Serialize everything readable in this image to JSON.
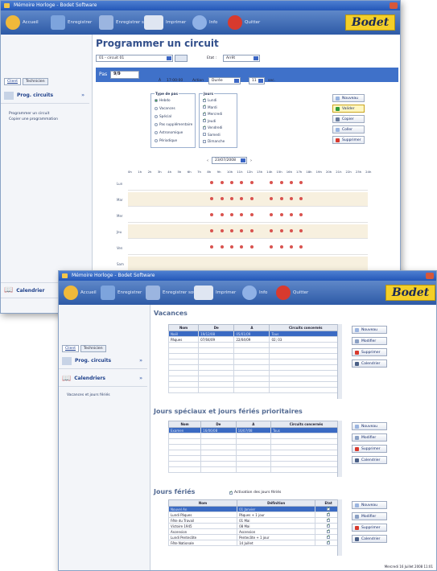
{
  "window1": {
    "title": "Mémoire Horloge - Bodet Software",
    "toolbar": {
      "home": "Accueil",
      "save": "Enregistrer",
      "save_as": "Enregistrer sous",
      "print": "Imprimer",
      "info": "Info",
      "quit": "Quitter"
    },
    "logo": "Bodet",
    "tabs": [
      "Client",
      "Technicien"
    ],
    "nav": {
      "heading": "Prog. circuits",
      "items": [
        "Programmer un circuit",
        "Copier une programmation"
      ],
      "calendar": "Calendrier"
    },
    "page_title": "Programmer un circuit",
    "circuit_select": "01 - circuit 01",
    "state_label": "Etat :",
    "state_value": "Arrêt",
    "pas_label": "Pas",
    "pas_value": "9/9",
    "time_prefix": "À",
    "time_value": "17:00:00",
    "action_label": "Action",
    "action_value": "Durée",
    "duration_value": "11",
    "duration_unit": "sec.",
    "type_group": {
      "title": "Type de pas",
      "items": [
        "Hebdo",
        "Vacances",
        "Spécial",
        "Pas supplémentaire",
        "Astronomique",
        "Périodique"
      ],
      "selected": 0
    },
    "days_group": {
      "title": "Jours",
      "items": [
        "Lundi",
        "Mardi",
        "Mercredi",
        "Jeudi",
        "Vendredi",
        "Samedi",
        "Dimanche"
      ],
      "checked": [
        true,
        true,
        true,
        true,
        true,
        false,
        false
      ]
    },
    "buttons": [
      "Nouveau",
      "Valider",
      "Copier",
      "Coller",
      "Supprimer"
    ],
    "date_nav": {
      "prev": "‹",
      "date": "23/07/2008",
      "next": "›"
    },
    "hours": [
      "0h",
      "1h",
      "2h",
      "3h",
      "4h",
      "5h",
      "6h",
      "7h",
      "8h",
      "9h",
      "10h",
      "11h",
      "12h",
      "13h",
      "14h",
      "15h",
      "16h",
      "17h",
      "18h",
      "19h",
      "20h",
      "21h",
      "22h",
      "23h",
      "24h"
    ],
    "days": [
      "Lun",
      "Mar",
      "Mer",
      "Jeu",
      "Ven",
      "Sam"
    ]
  },
  "window2": {
    "title": "Mémoire Horloge - Bodet Software",
    "logo": "Bodet",
    "tabs": [
      "Client",
      "Technicien"
    ],
    "nav": {
      "heading1": "Prog. circuits",
      "heading2": "Calendriers",
      "sub": "Vacances et jours fériés"
    },
    "vacances": {
      "title": "Vacances",
      "headers": [
        "Nom",
        "De",
        "A",
        "Circuits concernés"
      ],
      "rows": [
        [
          "Noël",
          "19/12/08",
          "05/01/09",
          "Tous"
        ],
        [
          "Pâques",
          "07/04/09",
          "22/04/09",
          "02; 03"
        ]
      ]
    },
    "speciaux": {
      "title": "Jours spéciaux et jours fériés prioritaires",
      "headers": [
        "Nom",
        "De",
        "A",
        "Circuits concernés"
      ],
      "rows": [
        [
          "Examen",
          "16/06/08",
          "16/07/08",
          "Tous"
        ]
      ]
    },
    "feries": {
      "title": "Jours fériés",
      "activation": "Activation des jours fériés",
      "headers": [
        "Nom",
        "Définition",
        "Etat"
      ],
      "rows": [
        [
          "Nouvel An",
          "01 Janvier"
        ],
        [
          "Lundi Pâques",
          "Pâques + 1 jour"
        ],
        [
          "Fête du Travail",
          "01 Mai"
        ],
        [
          "Victoire 1945",
          "08 Mai"
        ],
        [
          "Ascension",
          "Ascension"
        ],
        [
          "Lundi Pentecôte",
          "Pentecôte + 1 jour"
        ],
        [
          "Fête Nationale",
          "14 Juillet"
        ]
      ]
    },
    "side_buttons": [
      "Nouveau",
      "Modifier",
      "Supprimer",
      "Calendrier"
    ],
    "status": "Mercredi 16 Juillet 2008   11:01"
  },
  "colors": {
    "accent": "#3f71c9",
    "title_blue": "#324f8b",
    "dot_red": "#d9534f",
    "logo_yellow": "#f4cf28"
  }
}
